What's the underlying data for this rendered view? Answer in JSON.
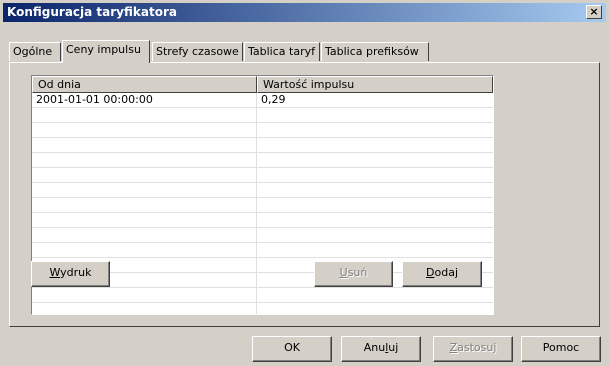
{
  "window": {
    "title": "Konfiguracja taryfikatora",
    "close_symbol": "×"
  },
  "tabs": [
    {
      "label": "Ogólne",
      "active": false
    },
    {
      "label": "Ceny impulsu",
      "active": true
    },
    {
      "label": "Strefy czasowe",
      "active": false
    },
    {
      "label": "Tablica taryf",
      "active": false
    },
    {
      "label": "Tablica prefiksów",
      "active": false
    }
  ],
  "table": {
    "columns": [
      "Od dnia",
      "Wartość impulsu"
    ],
    "rows": [
      [
        "2001-01-01 00:00:00",
        "0,29"
      ]
    ]
  },
  "panel_buttons": {
    "print": {
      "mnemonic": "W",
      "rest": "ydruk"
    },
    "delete": {
      "mnemonic": "U",
      "rest": "suń",
      "disabled": true
    },
    "add": {
      "mnemonic": "D",
      "rest": "odaj"
    }
  },
  "dialog_buttons": {
    "ok": "OK",
    "cancel": {
      "before": "Anu",
      "mnemonic": "l",
      "after": "uj"
    },
    "apply": {
      "mnemonic": "Z",
      "rest": "astosuj",
      "disabled": true
    },
    "help": "Pomoc"
  },
  "colors": {
    "title_start": "#0a246a",
    "title_end": "#a6caf0",
    "face": "#d4d0c8"
  }
}
